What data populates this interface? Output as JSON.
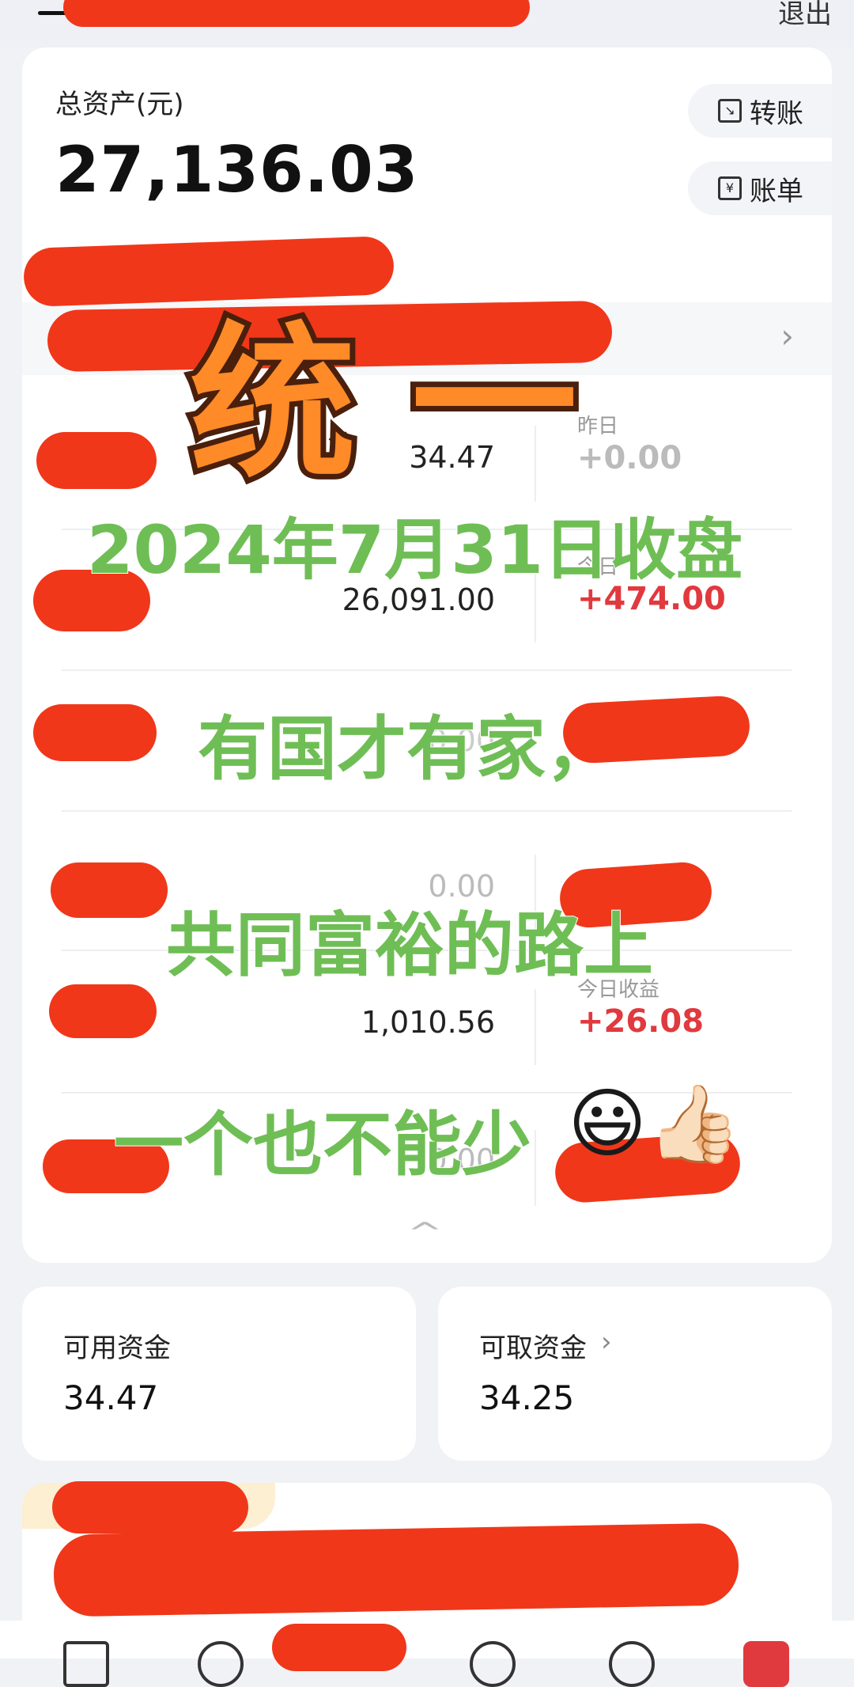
{
  "header": {
    "logout_label": "退出"
  },
  "account": {
    "total_assets_label": "总资产(元)",
    "total_assets_value": "27,136.03",
    "transfer_label": "转账",
    "statement_label": "账单",
    "transfer_icon": "transfer-icon",
    "statement_icon": "yen-receipt-icon"
  },
  "holdings": [
    {
      "value": "34.47",
      "sub_label": "昨日",
      "change": "+0.00",
      "status": "zero"
    },
    {
      "value": "26,091.00",
      "sub_label": "今日",
      "change": "+474.00",
      "status": "positive"
    },
    {
      "value": "0.00",
      "sub_label": "",
      "change": "",
      "status": "hidden"
    },
    {
      "value": "0.00",
      "sub_label": "",
      "change": "",
      "status": "hidden"
    },
    {
      "value": "1,010.56",
      "sub_label": "今日收益",
      "change": "+26.08",
      "status": "positive"
    },
    {
      "value": "0.00",
      "sub_label": "",
      "change": "",
      "status": "hidden"
    }
  ],
  "funds": {
    "available_label": "可用资金",
    "available_value": "34.47",
    "withdrawable_label": "可取资金",
    "withdrawable_value": "34.25",
    "chevron": "›"
  },
  "overlay": {
    "title": "统一",
    "date_line": "2024年7月31日收盘",
    "line1": "有国才有家，",
    "line2": "共同富裕的路上",
    "line3": "一个也不能少",
    "emoji": "😃👍🏻"
  },
  "colors": {
    "positive": "#e0393e",
    "redaction": "#f0371a",
    "overlay_green": "#6fbe55",
    "overlay_title_fill": "#ff8a28"
  }
}
